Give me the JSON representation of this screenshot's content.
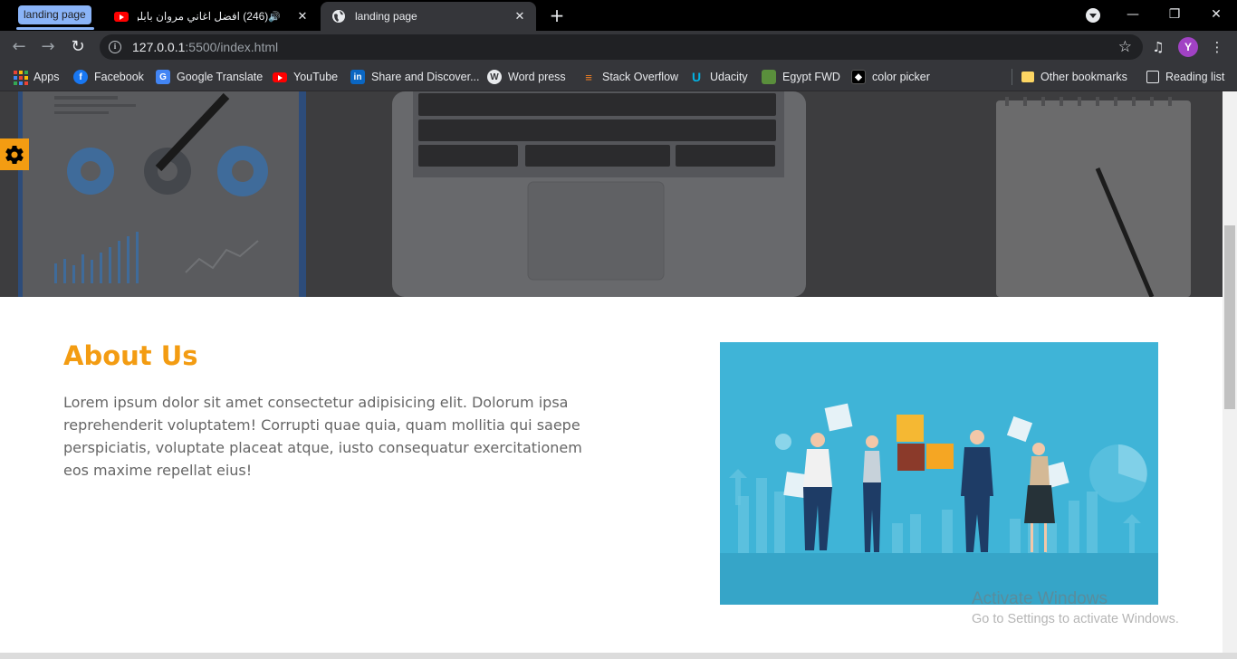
{
  "browser": {
    "tab_group_label": "landing page",
    "tabs": [
      {
        "title": "(246) افضل اغاني مروان بابلو",
        "favicon": "youtube-icon",
        "playing_audio": true
      },
      {
        "title": "landing page",
        "favicon": "globe-icon",
        "active": true
      }
    ],
    "address": {
      "host": "127.0.0.1",
      "path": ":5500/index.html"
    },
    "profile_initial": "Y",
    "accent_color": "#8ab4f8"
  },
  "bookmarks": [
    {
      "label": "Apps",
      "icon": "apps-grid-icon"
    },
    {
      "label": "Facebook",
      "icon": "facebook-icon"
    },
    {
      "label": "Google Translate",
      "icon": "google-translate-icon"
    },
    {
      "label": "YouTube",
      "icon": "youtube-icon"
    },
    {
      "label": "Share and Discover...",
      "icon": "linkedin-icon"
    },
    {
      "label": "Word press",
      "icon": "wordpress-icon"
    },
    {
      "label": "Stack Overflow",
      "icon": "stackoverflow-icon"
    },
    {
      "label": "Udacity",
      "icon": "udacity-icon"
    },
    {
      "label": "Egypt FWD",
      "icon": "egypt-fwd-icon"
    },
    {
      "label": "color picker",
      "icon": "color-picker-icon"
    }
  ],
  "bookmarks_right": [
    {
      "label": "Other bookmarks",
      "icon": "folder-icon"
    },
    {
      "label": "Reading list",
      "icon": "reading-list-icon"
    }
  ],
  "page": {
    "about": {
      "title": "About Us",
      "text": "Lorem ipsum dolor sit amet consectetur adipisicing elit. Dolorum ipsa reprehenderit voluptatem! Corrupti quae quia, quam mollitia qui saepe perspiciatis, voluptate placeat atque, iusto consequatur exercitationem eos maxime repellat eius!"
    },
    "accent_color": "#f39c12"
  },
  "os_watermark": {
    "line1": "Activate Windows",
    "line2": "Go to Settings to activate Windows."
  }
}
